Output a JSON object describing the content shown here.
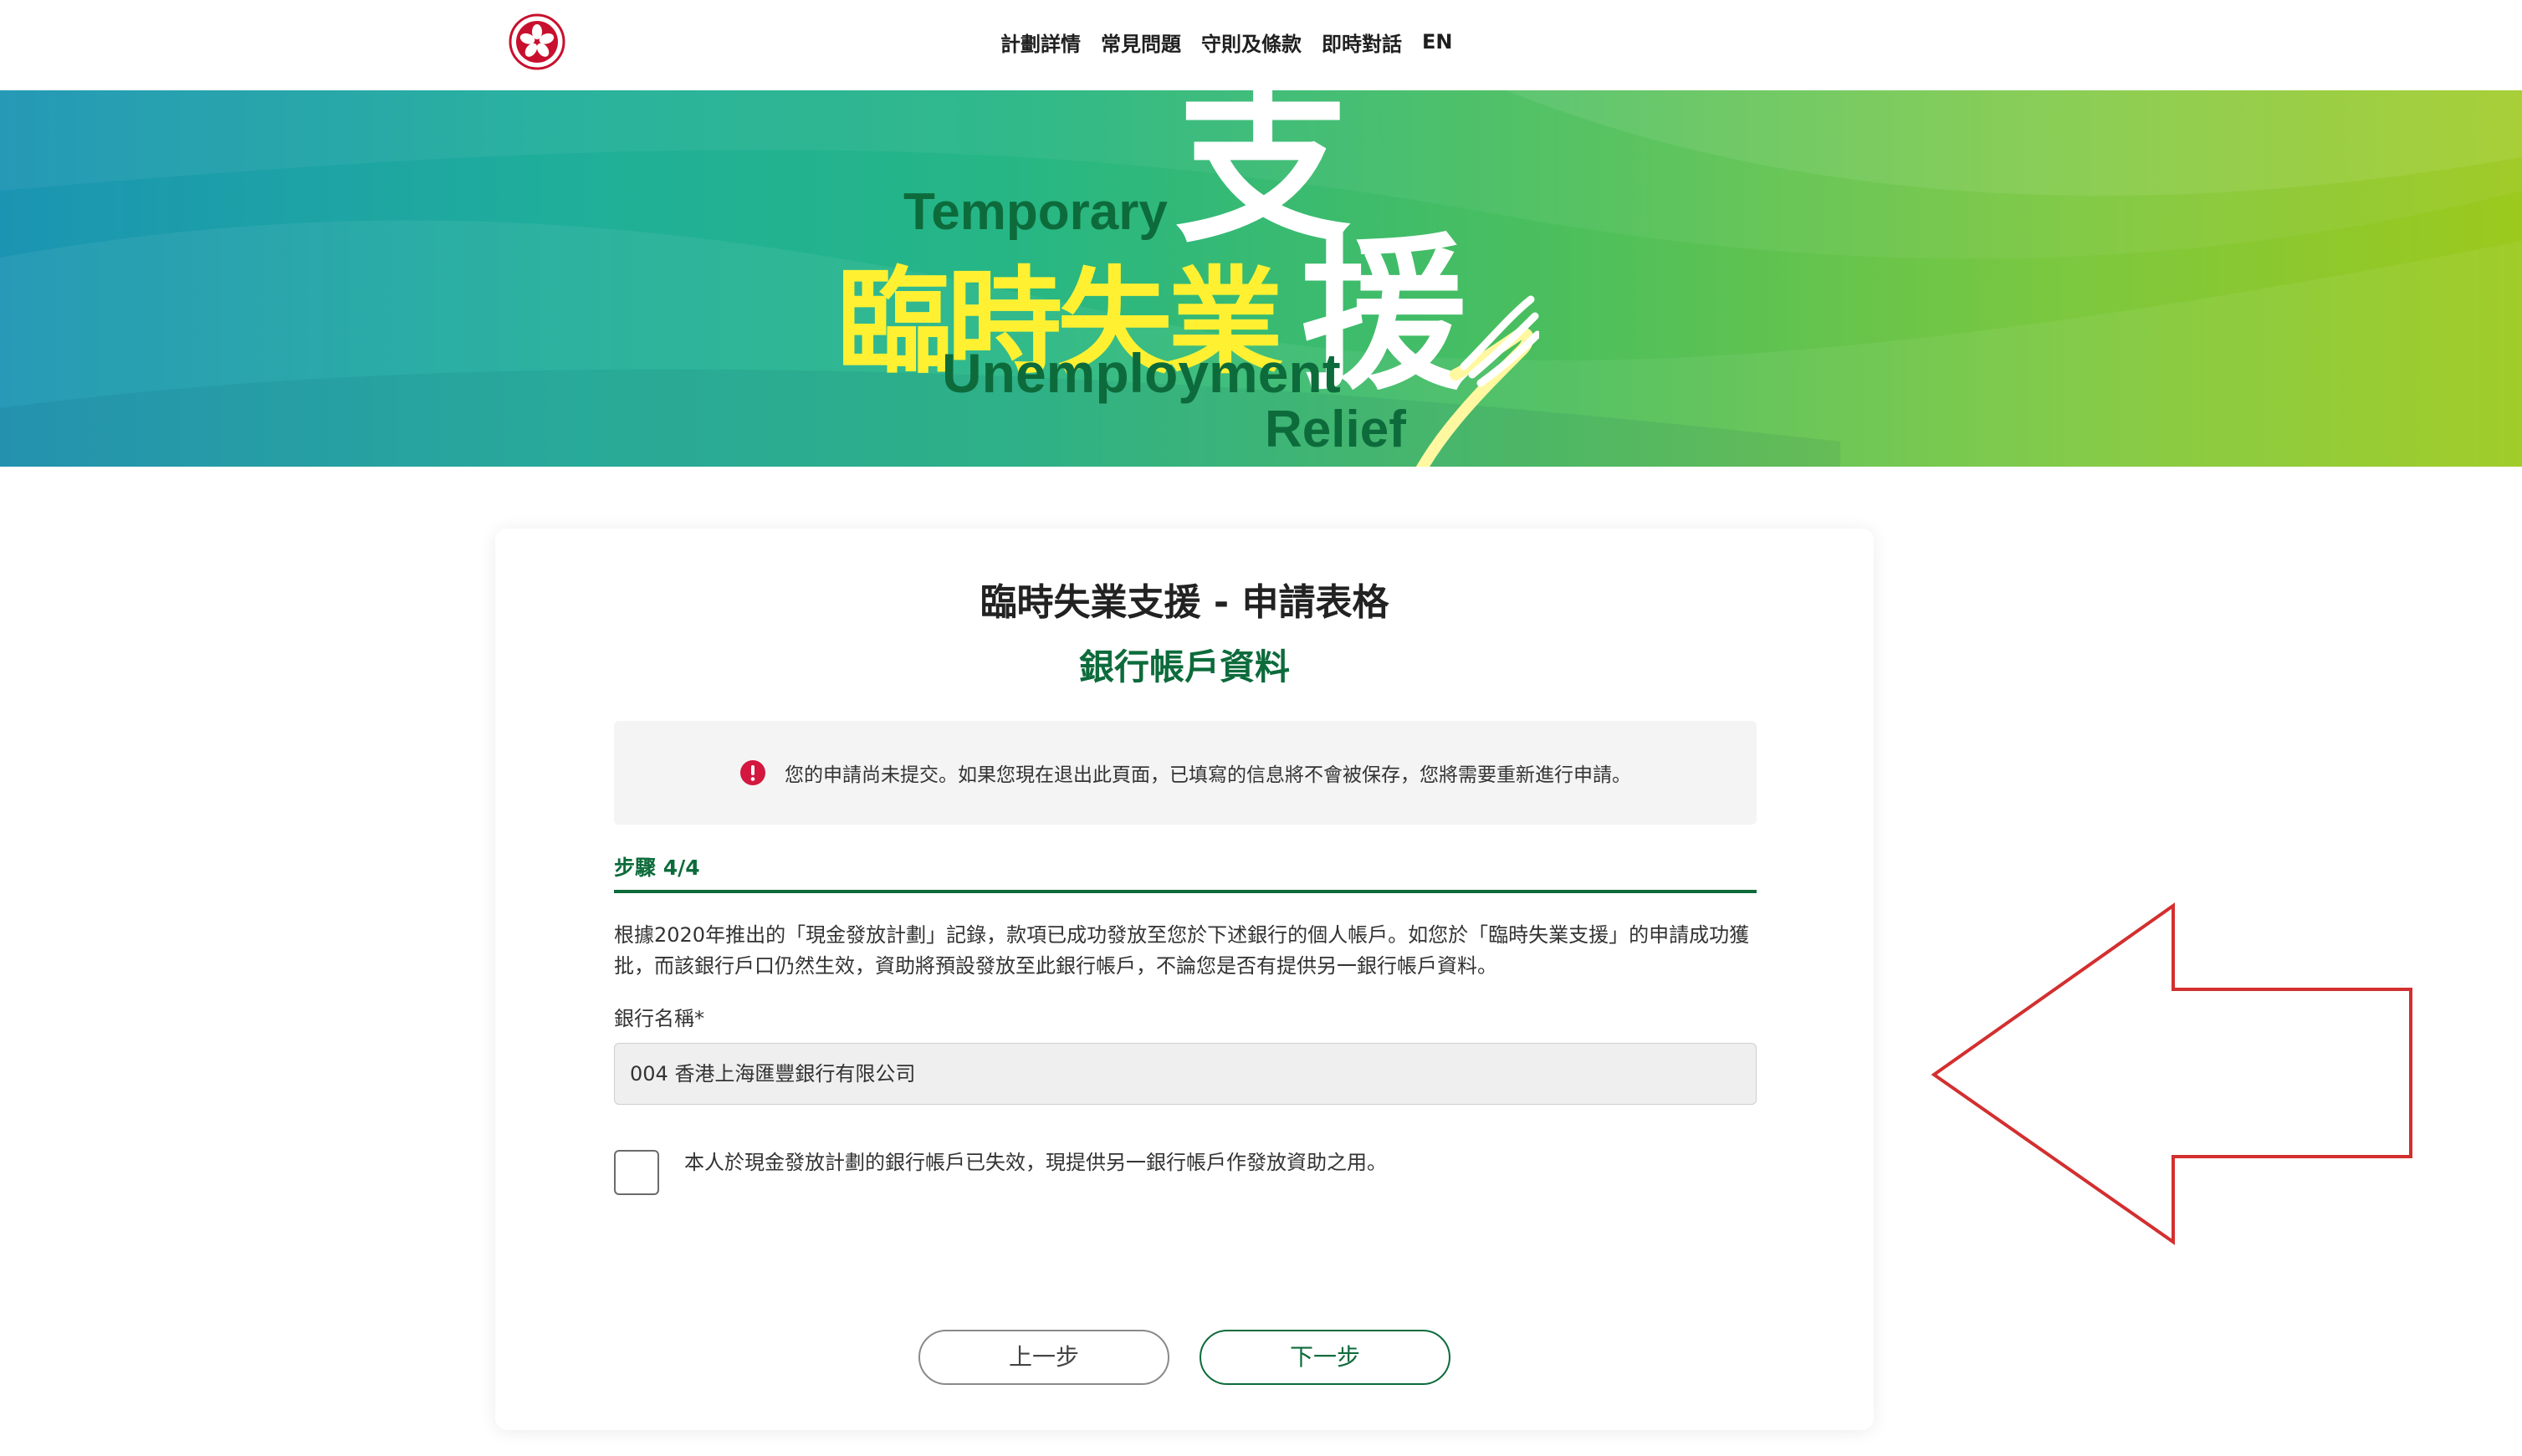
{
  "nav": {
    "emblem_icon": "hksar-bauhinia-emblem-icon",
    "links": [
      "計劃詳情",
      "常見問題",
      "守則及條款",
      "即時對話",
      "EN"
    ]
  },
  "banner": {
    "logo_en_top": "Temporary",
    "logo_cn": "臨時失業",
    "logo_big_1": "支",
    "logo_big_2": "援",
    "logo_en_mid": "Unemployment",
    "logo_en_bottom": "Relief"
  },
  "form": {
    "title": "臨時失業支援 - 申請表格",
    "subtitle": "銀行帳戶資料",
    "notice_icon": "exclamation-circle-icon",
    "notice": "您的申請尚未提交。如果您現在退出此頁面，已填寫的信息將不會被保存，您將需要重新進行申請。",
    "step": "步驟 4/4",
    "description_line1": "根據2020年推出的「現金發放計劃」記錄，款項已成功發放至您於下述銀行的個人帳戶。如您於「臨時失業支援」的申請成功獲",
    "description_line2": "批，而該銀行戶口仍然生效，資助將預設發放至此銀行帳戶，不論您是否有提供另一銀行帳戶資料。",
    "bank_label": "銀行名稱*",
    "bank_value": "004 香港上海匯豐銀行有限公司",
    "checkbox_checked": false,
    "checkbox_text": "本人於現金發放計劃的銀行帳戶已失效，現提供另一銀行帳戶作發放資助之用。",
    "prev_button": "上一步",
    "next_button": "下一步"
  },
  "colors": {
    "brand_green": "#0d6b3b",
    "logo_yellow": "#fff132",
    "notice_red": "#d3173f",
    "annotation_red": "#d32f2f"
  }
}
